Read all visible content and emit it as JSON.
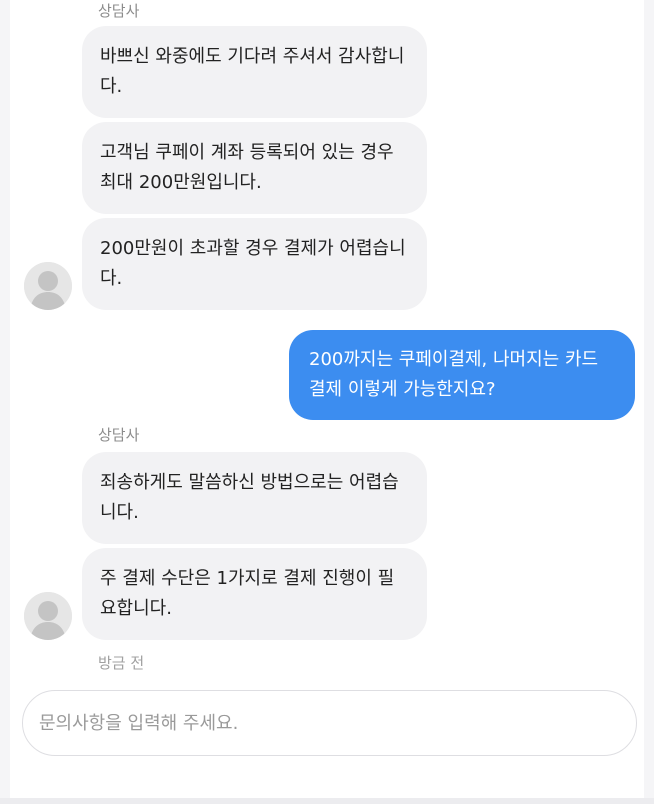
{
  "conversation": {
    "groups": [
      {
        "sender": "상담사",
        "messages": [
          "바쁘신 와중에도 기다려 주셔서 감사합니다.",
          "고객님  쿠페이 계좌 등록되어 있는 경우 최대 200만원입니다.",
          "200만원이 초과할 경우 결제가 어렵습니다."
        ]
      },
      {
        "sender": "상담사",
        "messages": [
          "죄송하게도 말씀하신 방법으로는 어렵습니다.",
          "주 결제 수단은 1가지로 결제 진행이 필요합니다."
        ]
      }
    ],
    "user_message": "200까지는 쿠페이결제, 나머지는 카드 결제 이렇게 가능한지요?",
    "timestamp": "방금 전"
  },
  "composer": {
    "placeholder": "문의사항을 입력해 주세요.",
    "value": ""
  },
  "colors": {
    "user_bubble": "#3c8df0",
    "agent_bubble": "#f2f2f4"
  },
  "icons": {
    "avatar": "person-icon"
  }
}
